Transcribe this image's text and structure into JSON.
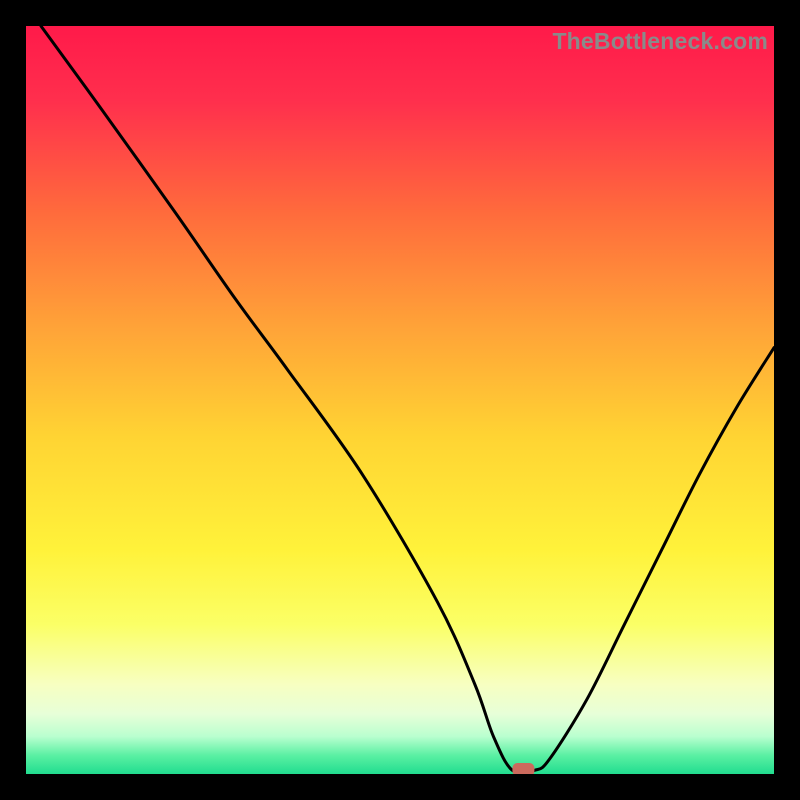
{
  "watermark": "TheBottleneck.com",
  "chart_data": {
    "type": "line",
    "title": "",
    "xlabel": "",
    "ylabel": "",
    "xlim": [
      0,
      100
    ],
    "ylim": [
      0,
      100
    ],
    "grid": false,
    "legend": false,
    "curve": {
      "name": "bottleneck-curve",
      "x": [
        2,
        10,
        20,
        28,
        35,
        45,
        55,
        60,
        62.5,
        65,
        68,
        70,
        75,
        80,
        85,
        90,
        95,
        100
      ],
      "y": [
        100,
        89,
        75,
        63.5,
        54,
        40,
        23,
        12,
        5,
        0.5,
        0.5,
        2,
        10,
        20,
        30,
        40,
        49,
        57
      ]
    },
    "marker": {
      "name": "sweet-spot",
      "x": 66.5,
      "y": 0.6,
      "color": "#cc6a5d"
    },
    "gradient_stops": [
      {
        "pos": 0.0,
        "color": "#ff1a4a"
      },
      {
        "pos": 0.1,
        "color": "#ff2f4d"
      },
      {
        "pos": 0.25,
        "color": "#ff6b3c"
      },
      {
        "pos": 0.4,
        "color": "#ffa238"
      },
      {
        "pos": 0.55,
        "color": "#ffd433"
      },
      {
        "pos": 0.7,
        "color": "#fff23a"
      },
      {
        "pos": 0.8,
        "color": "#fbff66"
      },
      {
        "pos": 0.88,
        "color": "#f7ffc1"
      },
      {
        "pos": 0.92,
        "color": "#e7ffd8"
      },
      {
        "pos": 0.95,
        "color": "#b9ffcf"
      },
      {
        "pos": 0.975,
        "color": "#5bf0a3"
      },
      {
        "pos": 1.0,
        "color": "#21dd8f"
      }
    ]
  }
}
